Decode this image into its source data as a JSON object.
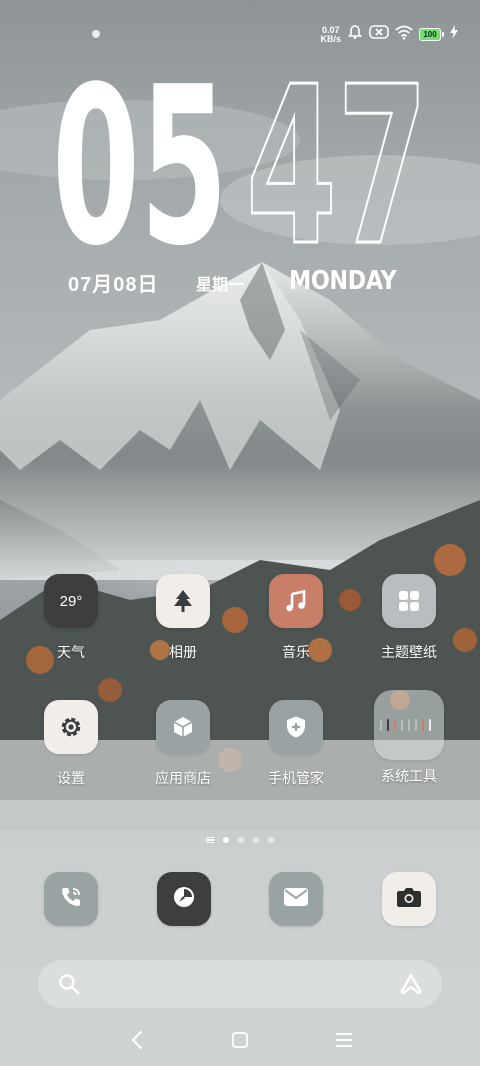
{
  "status_bar": {
    "net_speed_value": "0.07",
    "net_speed_unit": "KB/s",
    "battery_level": "100",
    "icons": [
      "alarm-icon",
      "no-sim-icon",
      "wifi-icon",
      "battery-icon",
      "charging-icon"
    ]
  },
  "clock": {
    "hours": "05",
    "minutes": "47",
    "date": "07月08日",
    "weekday_cn": "星期一",
    "weekday_en": "MONDAY"
  },
  "apps": [
    {
      "label": "天气",
      "icon": "weather-icon",
      "temp": "29°"
    },
    {
      "label": "相册",
      "icon": "gallery-tree-icon"
    },
    {
      "label": "音乐",
      "icon": "music-note-icon"
    },
    {
      "label": "主题壁纸",
      "icon": "themes-icon"
    },
    {
      "label": "设置",
      "icon": "settings-gear-icon"
    },
    {
      "label": "应用商店",
      "icon": "app-store-cube-icon"
    },
    {
      "label": "手机管家",
      "icon": "security-shield-icon"
    },
    {
      "label": "系统工具",
      "icon": "system-tools-folder-icon"
    }
  ],
  "page_indicator": {
    "pages": 4,
    "current": 1
  },
  "dock": [
    {
      "icon": "phone-icon"
    },
    {
      "icon": "browser-icon"
    },
    {
      "icon": "messages-icon"
    },
    {
      "icon": "camera-icon"
    }
  ],
  "search": {
    "placeholder": ""
  },
  "nav": [
    "back-icon",
    "home-icon",
    "recents-icon"
  ],
  "colors": {
    "accent_red": "#c97e6a",
    "dark_tile": "#3d3f3f",
    "light_tile": "#f1eeea",
    "battery_green": "#6fe06a"
  }
}
